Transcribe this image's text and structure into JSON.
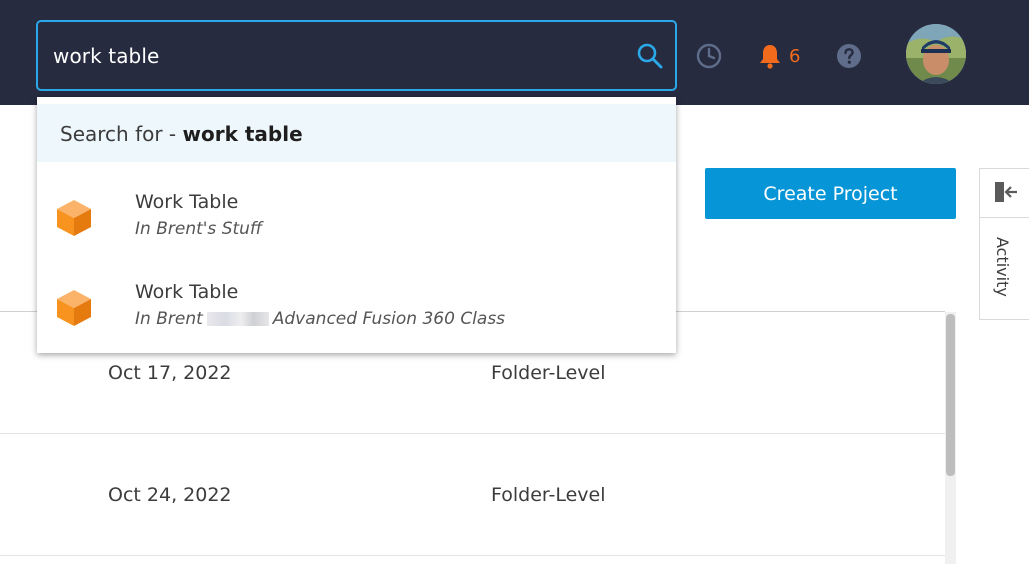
{
  "header": {
    "search": {
      "value": "work table"
    },
    "notifications": {
      "count": "6"
    }
  },
  "dropdown": {
    "search_for_prefix": "Search for - ",
    "search_for_term": "work table",
    "results": [
      {
        "title": "Work Table",
        "sub_prefix": "In ",
        "location_a": "Brent's Stuff",
        "location_b": ""
      },
      {
        "title": "Work Table",
        "sub_prefix": "In ",
        "location_a": "Brent",
        "location_b": "Advanced Fusion 360 Class"
      }
    ]
  },
  "main": {
    "create_project_label": "Create Project",
    "activity_label": "Activity",
    "rows": [
      {
        "date": "Oct 17, 2022",
        "level": "Folder-Level"
      },
      {
        "date": "Oct 24, 2022",
        "level": "Folder-Level"
      }
    ]
  },
  "colors": {
    "header_bg": "#262b3f",
    "accent": "#0696d7",
    "search_border": "#2aa8e8",
    "notification": "#f26b1c",
    "cube": "#f7931e"
  },
  "icons": [
    "search-icon",
    "clock-icon",
    "bell-icon",
    "help-icon",
    "cube-icon",
    "collapse-panel-icon"
  ]
}
